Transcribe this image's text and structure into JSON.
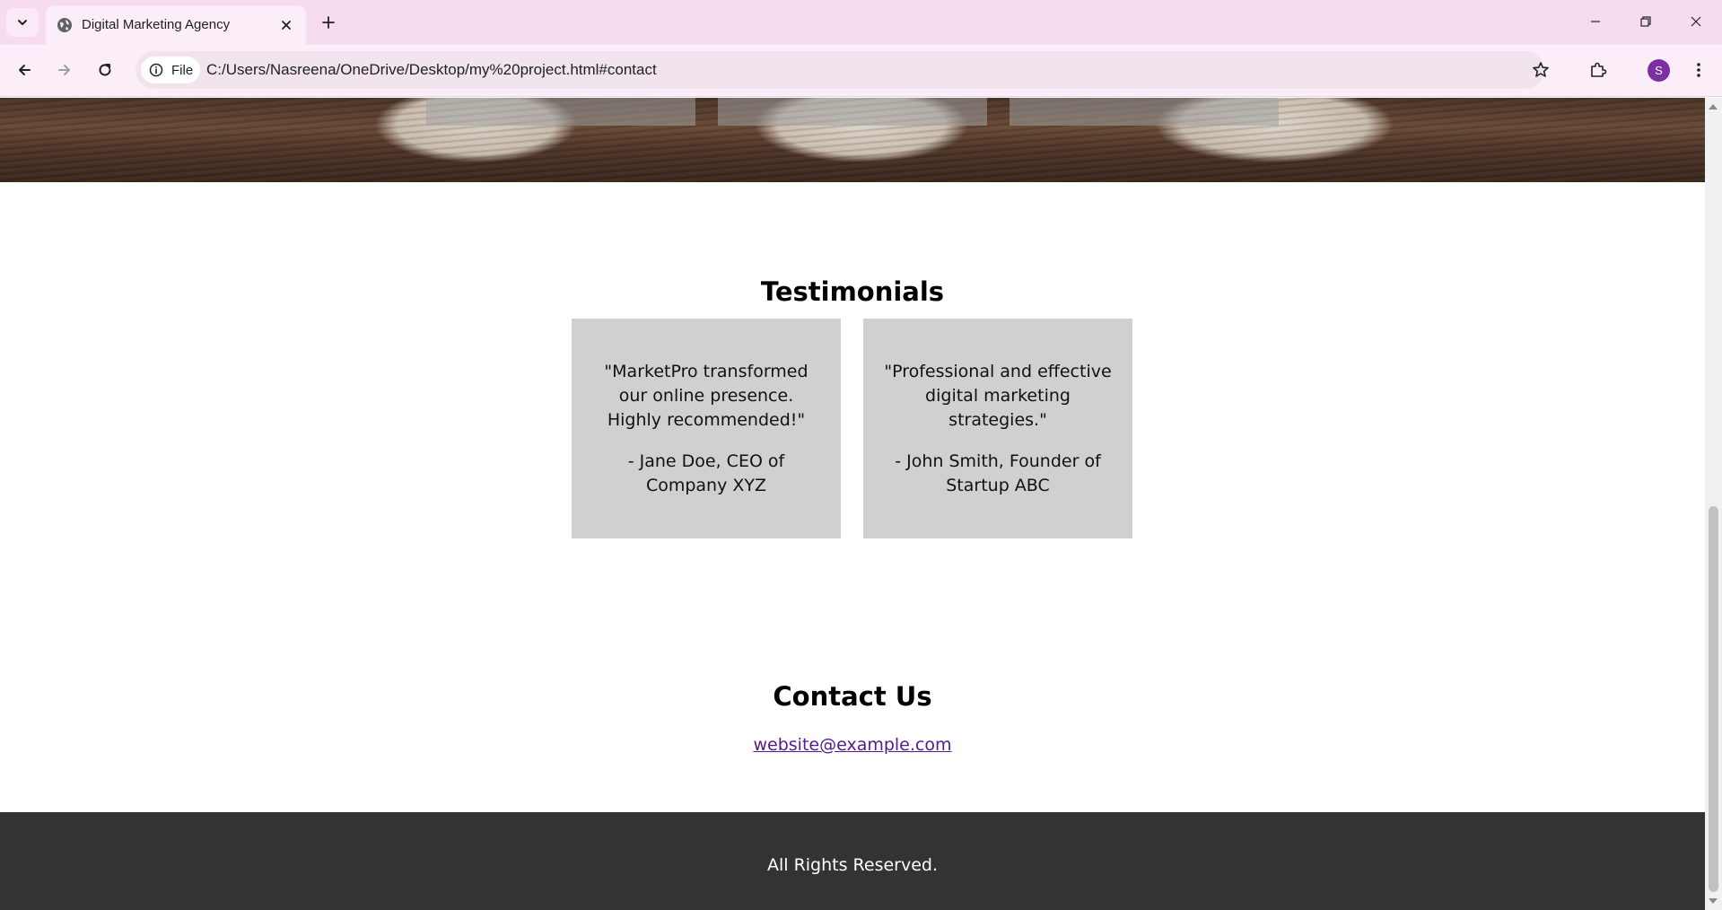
{
  "browser": {
    "tab": {
      "title": "Digital Marketing Agency",
      "favicon": "globe-icon"
    },
    "address_bar": {
      "site_chip_label": "File",
      "url": "C:/Users/Nasreena/OneDrive/Desktop/my%20project.html#contact"
    },
    "profile_initial": "S",
    "colors": {
      "tabbar": "#f7dcef",
      "toolbar": "#fbeef8",
      "avatar": "#7b2fa3"
    }
  },
  "page": {
    "testimonials": {
      "heading": "Testimonials",
      "items": [
        {
          "quote": "\"MarketPro transformed our online presence. Highly recommended!\"",
          "author": "- Jane Doe, CEO of Company XYZ"
        },
        {
          "quote": "\"Professional and effective digital marketing strategies.\"",
          "author": "- John Smith, Founder of Startup ABC"
        }
      ]
    },
    "contact": {
      "heading": "Contact Us",
      "email": "website@example.com"
    },
    "footer": {
      "text": "All Rights Reserved."
    },
    "colors": {
      "card_bg": "#d0d0d0",
      "footer_bg": "#333333",
      "link": "#551a8b"
    }
  }
}
